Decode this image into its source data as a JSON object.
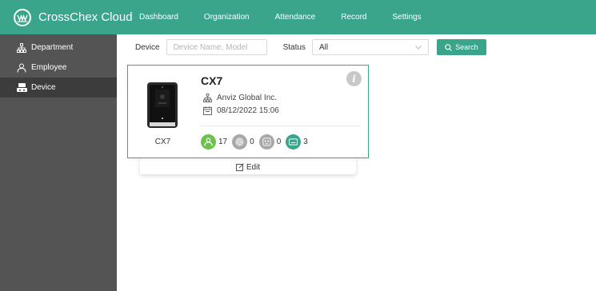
{
  "app": {
    "brand": "CrossChex Cloud",
    "nav": [
      "Dashboard",
      "Organization",
      "Attendance",
      "Record",
      "Settings"
    ]
  },
  "sidebar": {
    "items": [
      {
        "label": "Department",
        "icon": "org-chart-icon",
        "active": false
      },
      {
        "label": "Employee",
        "icon": "person-icon",
        "active": false
      },
      {
        "label": "Device",
        "icon": "device-icon",
        "active": true
      }
    ]
  },
  "filter": {
    "device_label": "Device",
    "device_placeholder": "Device Name, Model",
    "status_label": "Status",
    "status_value": "All",
    "search_label": "Search"
  },
  "device_card": {
    "model": "CX7",
    "caption": "CX7",
    "company": "Anviz Global Inc.",
    "datetime": "08/12/2022 15:06",
    "stats": {
      "users": "17",
      "fingerprints": "0",
      "faces": "0",
      "cards": "3"
    },
    "edit_label": "Edit"
  },
  "colors": {
    "accent": "#3aa58a",
    "sidebar_bg": "#545454",
    "sidebar_active": "#3c3c3c",
    "user_badge": "#6cc24a",
    "fingerprint_badge": "#a8a8a8",
    "face_badge": "#a8a8a8",
    "card_badge": "#3aa58a"
  }
}
